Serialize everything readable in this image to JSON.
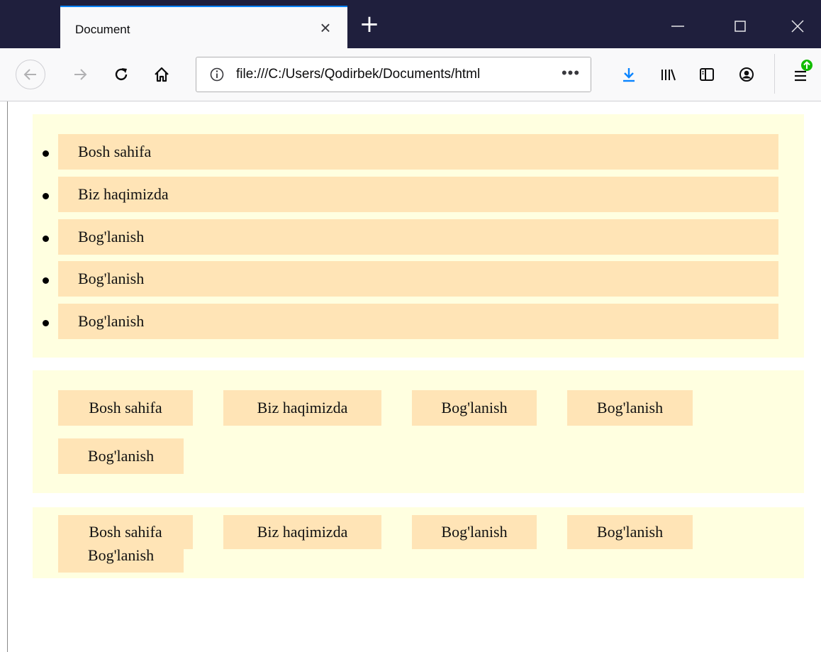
{
  "browser": {
    "tab_title": "Document",
    "tab_close": "×",
    "new_tab": "+",
    "url": "file:///C:/Users/Qodirbek/Documents/html",
    "url_more": "•••",
    "accent_color": "#0a84ff",
    "icons": [
      "back-icon",
      "forward-icon",
      "reload-icon",
      "home-icon",
      "info-icon",
      "download-icon",
      "library-icon",
      "sidebar-icon",
      "account-icon",
      "menu-update-icon",
      "minimize-icon",
      "maximize-icon",
      "close-icon"
    ]
  },
  "page": {
    "panel_color": "#ffffe0",
    "item_color": "#ffe4b6",
    "vertical_menu": {
      "items": [
        "Bosh sahifa",
        "Biz haqimizda",
        "Bog'lanish",
        "Bog'lanish",
        "Bog'lanish"
      ]
    },
    "horizontal_menu": {
      "items": [
        "Bosh sahifa",
        "Biz haqimizda",
        "Bog'lanish",
        "Bog'lanish",
        "Bog'lanish"
      ]
    },
    "compact_menu": {
      "items": [
        "Bosh sahifa",
        "Biz haqimizda",
        "Bog'lanish",
        "Bog'lanish",
        "Bog'lanish"
      ]
    }
  }
}
